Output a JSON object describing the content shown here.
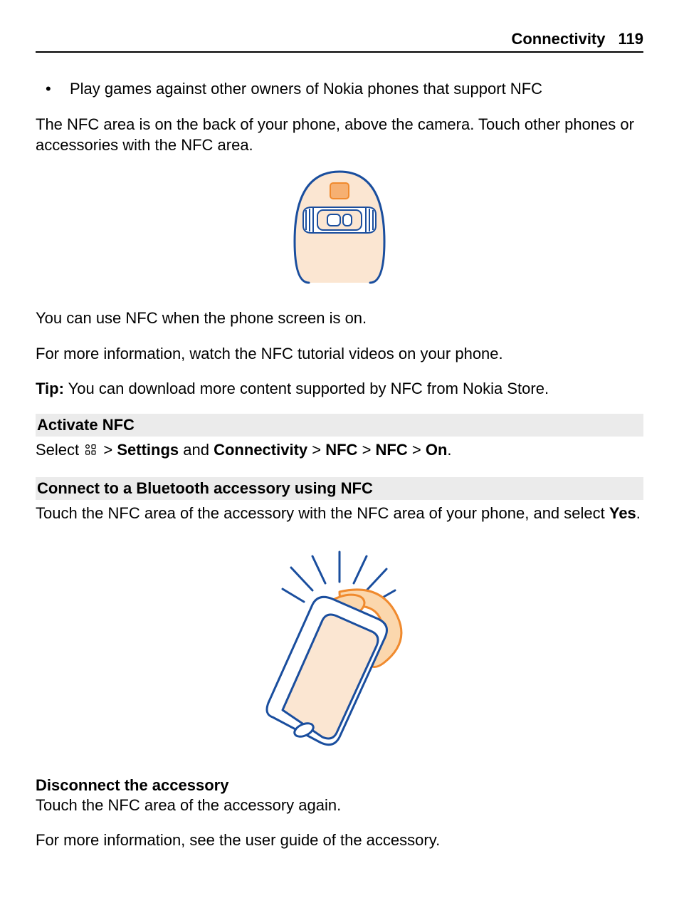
{
  "header": {
    "section": "Connectivity",
    "page": "119"
  },
  "bullet1": "Play games against other owners of Nokia phones that support NFC",
  "para_nfc_area": "The NFC area is on the back of your phone, above the camera. Touch other phones or accessories with the NFC area.",
  "para_screen_on": "You can use NFC when the phone screen is on.",
  "para_tutorial": "For more information, watch the NFC tutorial videos on your phone.",
  "tip_label": "Tip:",
  "tip_text": " You can download more content supported by NFC from Nokia Store.",
  "sec_activate": "Activate NFC",
  "instr_select": "Select ",
  "instr_gt1": " > ",
  "instr_settings": "Settings",
  "instr_and": " and ",
  "instr_connectivity": "Connectivity",
  "instr_gt2": " > ",
  "instr_nfc1": "NFC",
  "instr_gt3": " > ",
  "instr_nfc2": "NFC",
  "instr_gt4": " > ",
  "instr_on": "On",
  "instr_period": ".",
  "sec_connect": "Connect to a Bluetooth accessory using NFC",
  "connect_text_a": "Touch the NFC area of the accessory with the NFC area of your phone, and select ",
  "connect_yes": "Yes",
  "connect_text_b": ".",
  "sub_disconnect": "Disconnect the accessory",
  "disconnect_text": "Touch the NFC area of the accessory again.",
  "more_info": "For more information, see the user guide of the accessory."
}
